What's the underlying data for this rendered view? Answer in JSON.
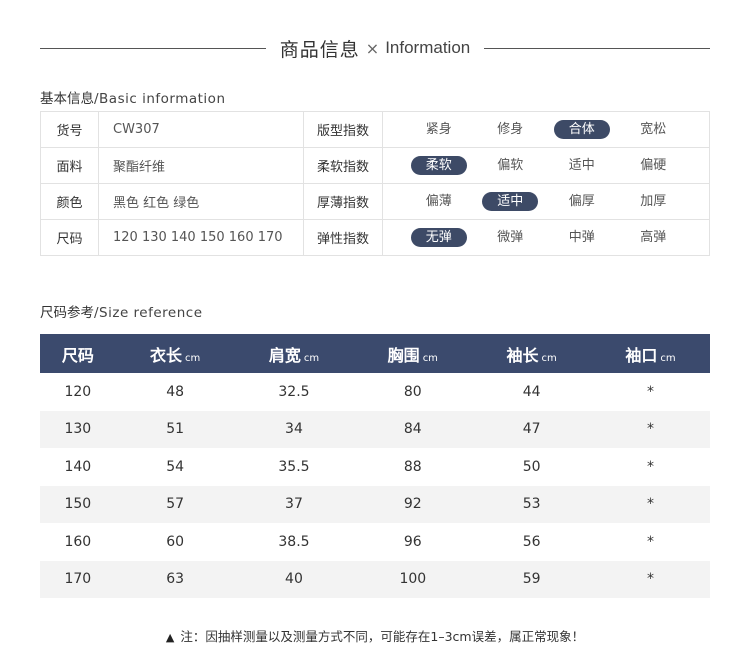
{
  "header": {
    "title_cn": "商品信息",
    "times": "×",
    "title_en": "Information"
  },
  "basic": {
    "title_cn": "基本信息",
    "title_en": "/Basic information",
    "rows": [
      {
        "label": "货号",
        "value": "CW307",
        "index": "版型指数",
        "options": [
          "紧身",
          "修身",
          "合体",
          "宽松"
        ],
        "selected": 2
      },
      {
        "label": "面料",
        "value": "聚酯纤维",
        "index": "柔软指数",
        "options": [
          "柔软",
          "偏软",
          "适中",
          "偏硬"
        ],
        "selected": 0
      },
      {
        "label": "颜色",
        "value": "黑色  红色  绿色",
        "index": "厚薄指数",
        "options": [
          "偏薄",
          "适中",
          "偏厚",
          "加厚"
        ],
        "selected": 1
      },
      {
        "label": "尺码",
        "value": "120  130  140  150  160  170",
        "index": "弹性指数",
        "options": [
          "无弹",
          "微弹",
          "中弹",
          "高弹"
        ],
        "selected": 0
      }
    ]
  },
  "size": {
    "title_cn": "尺码参考",
    "title_en": "/Size reference",
    "headers": [
      {
        "label": "尺码",
        "unit": ""
      },
      {
        "label": "衣长",
        "unit": "cm"
      },
      {
        "label": "肩宽",
        "unit": "cm"
      },
      {
        "label": "胸围",
        "unit": "cm"
      },
      {
        "label": "袖长",
        "unit": "cm"
      },
      {
        "label": "袖口",
        "unit": "cm"
      }
    ],
    "rows": [
      [
        "120",
        "48",
        "32.5",
        "80",
        "44",
        "*"
      ],
      [
        "130",
        "51",
        "34",
        "84",
        "47",
        "*"
      ],
      [
        "140",
        "54",
        "35.5",
        "88",
        "50",
        "*"
      ],
      [
        "150",
        "57",
        "37",
        "92",
        "53",
        "*"
      ],
      [
        "160",
        "60",
        "38.5",
        "96",
        "56",
        "*"
      ],
      [
        "170",
        "63",
        "40",
        "100",
        "59",
        "*"
      ]
    ]
  },
  "note": {
    "icon": "warning-triangle-icon",
    "text": "注：因抽样测量以及测量方式不同，可能存在1–3cm误差，属正常现象！"
  },
  "colors": {
    "header_bg": "#3b4a6d",
    "selected_pill": "#3d4a66",
    "alt_row": "#f3f3f3"
  }
}
